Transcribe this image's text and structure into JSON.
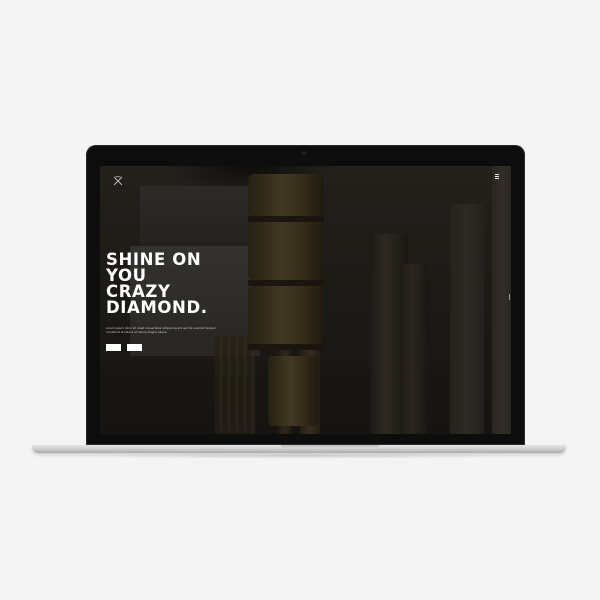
{
  "site": {
    "hero": {
      "title": "SHINE ON\nYOU\nCRAZY\nDIAMOND.",
      "text": "Lorem ipsum dolor sit amet consectetur adipiscing elit sed do eiusmod tempor incididunt ut labore et dolore magna aliqua."
    },
    "buttons": {
      "primary_label": "",
      "secondary_label": ""
    },
    "icons": {
      "logo": "crossed-x-logo-icon",
      "menu": "hamburger-menu-icon"
    }
  },
  "colors": {
    "page_background": "#f4f4f4",
    "bezel": "#0d0d0d",
    "hero_text": "#ffffff",
    "button_fill": "#ffffff",
    "laptop_base": "#cfcfcf"
  }
}
